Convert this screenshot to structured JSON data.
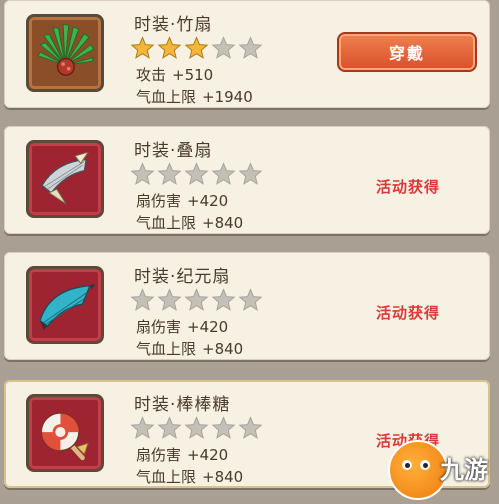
{
  "colors": {
    "star_filled": "#f2b63a",
    "star_empty": "#c4c0b8",
    "source_text": "#d83a3a",
    "button": "#e5643a"
  },
  "items": [
    {
      "name": "时装·竹扇",
      "stars": 3,
      "stats": [
        {
          "label": "攻击",
          "value": "+510"
        },
        {
          "label": "气血上限",
          "value": "+1940"
        }
      ],
      "action": "穿戴",
      "icon": "bamboo-fan-icon"
    },
    {
      "name": "时装·叠扇",
      "stars": 0,
      "stats": [
        {
          "label": "扇伤害",
          "value": "+420"
        },
        {
          "label": "气血上限",
          "value": "+840"
        }
      ],
      "source": "活动获得",
      "icon": "folding-fan-icon"
    },
    {
      "name": "时装·纪元扇",
      "stars": 0,
      "stats": [
        {
          "label": "扇伤害",
          "value": "+420"
        },
        {
          "label": "气血上限",
          "value": "+840"
        }
      ],
      "source": "活动获得",
      "icon": "epoch-fan-icon"
    },
    {
      "name": "时装·棒棒糖",
      "stars": 0,
      "stats": [
        {
          "label": "扇伤害",
          "value": "+420"
        },
        {
          "label": "气血上限",
          "value": "+840"
        }
      ],
      "source": "活动获得",
      "icon": "lollipop-icon"
    }
  ],
  "watermark": {
    "text": "九游"
  }
}
